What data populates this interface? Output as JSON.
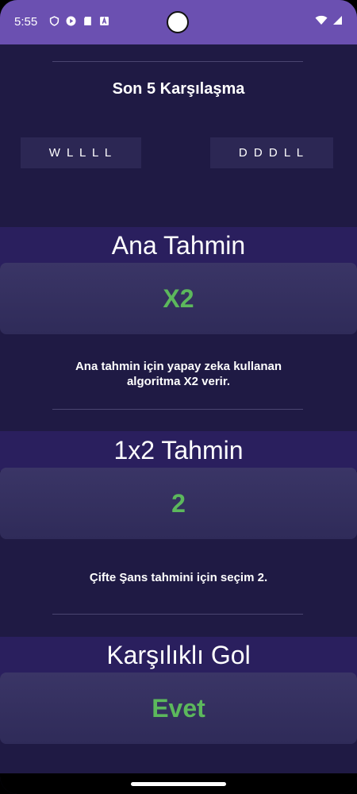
{
  "status": {
    "time": "5:55",
    "icons": [
      "shield-icon",
      "play-icon",
      "sdcard-icon",
      "font-icon"
    ],
    "right_icons": [
      "wifi-icon",
      "signal-icon"
    ]
  },
  "form": {
    "title": "Son 5 Karşılaşma",
    "home": "W L L L L",
    "away": "D D D L L"
  },
  "main": {
    "title": "Ana Tahmin",
    "value": "X2",
    "description": "Ana tahmin için yapay zeka kullanan algoritma X2 verir."
  },
  "one_x_two": {
    "title": "1x2 Tahmin",
    "value": "2",
    "description": "Çifte Şans tahmini için seçim 2."
  },
  "btts": {
    "title": "Karşılıklı Gol",
    "value": "Evet"
  },
  "colors": {
    "accent": "#5cb85c",
    "statusbar": "#6b50b1",
    "background": "#1f1a44"
  }
}
